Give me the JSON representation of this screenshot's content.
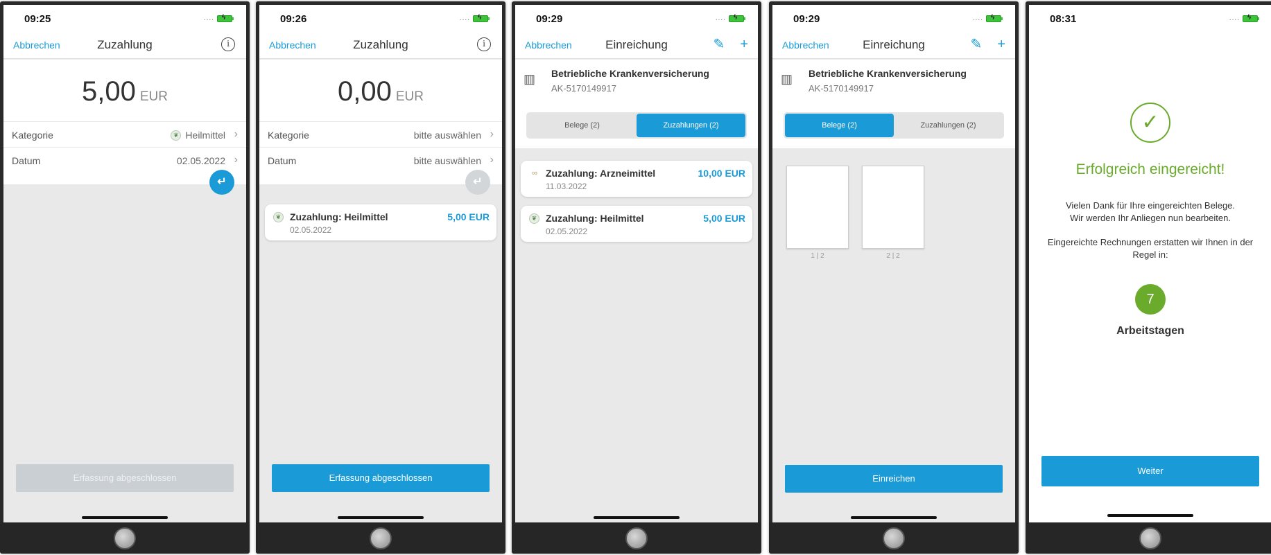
{
  "colors": {
    "accent": "#1a9bd7",
    "success": "#6aab2c",
    "disabled_button": "#c9cfd3",
    "fab_disabled": "#d2d6d9"
  },
  "screens": [
    {
      "time": "09:25",
      "nav_left": "Abbrechen",
      "nav_title": "Zuzahlung",
      "amount": "5,00",
      "currency": "EUR",
      "rows": [
        {
          "label": "Kategorie",
          "value": "Heilmittel",
          "icon": "leaf-icon"
        },
        {
          "label": "Datum",
          "value": "02.05.2022"
        }
      ],
      "fab": "return-icon",
      "button": "Erfassung abgeschlossen",
      "button_state": "disabled"
    },
    {
      "time": "09:26",
      "nav_left": "Abbrechen",
      "nav_title": "Zuzahlung",
      "amount": "0,00",
      "currency": "EUR",
      "rows": [
        {
          "label": "Kategorie",
          "value": "bitte auswählen"
        },
        {
          "label": "Datum",
          "value": "bitte auswählen"
        }
      ],
      "fab": "return-icon",
      "fab_state": "disabled",
      "cards": [
        {
          "title": "Zuzahlung: Heilmittel",
          "date": "02.05.2022",
          "amount": "5,00 EUR",
          "icon": "leaf-icon"
        }
      ],
      "button": "Erfassung abgeschlossen",
      "button_state": "enabled"
    },
    {
      "time": "09:29",
      "nav_left": "Abbrechen",
      "nav_title": "Einreichung",
      "insurer_name": "Betriebliche Krankenversicherung",
      "insurer_id": "AK-5170149917",
      "tabs": [
        "Belege (2)",
        "Zuzahlungen (2)"
      ],
      "active_tab": 1,
      "cards": [
        {
          "title": "Zuzahlung: Arzneimittel",
          "date": "11.03.2022",
          "amount": "10,00 EUR",
          "icon": "glasses-icon"
        },
        {
          "title": "Zuzahlung: Heilmittel",
          "date": "02.05.2022",
          "amount": "5,00 EUR",
          "icon": "leaf-icon"
        }
      ]
    },
    {
      "time": "09:29",
      "nav_left": "Abbrechen",
      "nav_title": "Einreichung",
      "insurer_name": "Betriebliche Krankenversicherung",
      "insurer_id": "AK-5170149917",
      "tabs": [
        "Belege (2)",
        "Zuzahlungen (2)"
      ],
      "active_tab": 0,
      "thumbnails": [
        "1 | 2",
        "2 | 2"
      ],
      "button": "Einreichen"
    },
    {
      "time": "08:31",
      "success_title": "Erfolgreich eingereicht!",
      "text1_line1": "Vielen Dank für Ihre eingereichten Belege.",
      "text1_line2": "Wir werden Ihr Anliegen nun bearbeiten.",
      "text2_line1": "Eingereichte Rechnungen erstatten wir Ihnen in der",
      "text2_line2": "Regel in:",
      "days": "7",
      "days_label": "Arbeitstagen",
      "button": "Weiter"
    }
  ]
}
